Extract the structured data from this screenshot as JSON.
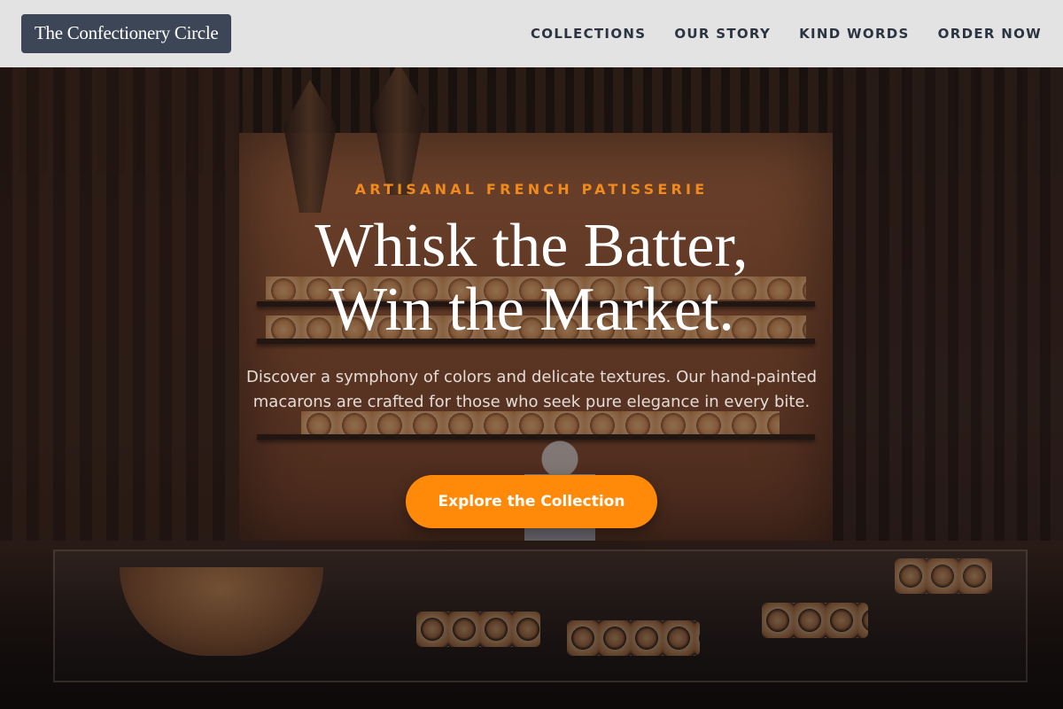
{
  "header": {
    "brand": "The Confectionery Circle",
    "nav": [
      {
        "label": "COLLECTIONS"
      },
      {
        "label": "OUR STORY"
      },
      {
        "label": "KIND WORDS"
      },
      {
        "label": "ORDER NOW"
      }
    ]
  },
  "hero": {
    "eyebrow": "ARTISANAL FRENCH PATISSERIE",
    "headline_line1": "Whisk the Batter,",
    "headline_line2": "Win the Market.",
    "subtext": "Discover a symphony of colors and delicate textures. Our hand-painted macarons are crafted for those who seek pure elegance in every bite.",
    "cta_label": "Explore the Collection",
    "background_image": "bakery-interior-photo"
  },
  "colors": {
    "accent": "#ff8a0a",
    "eyebrow": "#f08a1c",
    "brand_bg": "#3d4656",
    "header_bg": "#ececec",
    "nav_text": "#2c3442"
  }
}
